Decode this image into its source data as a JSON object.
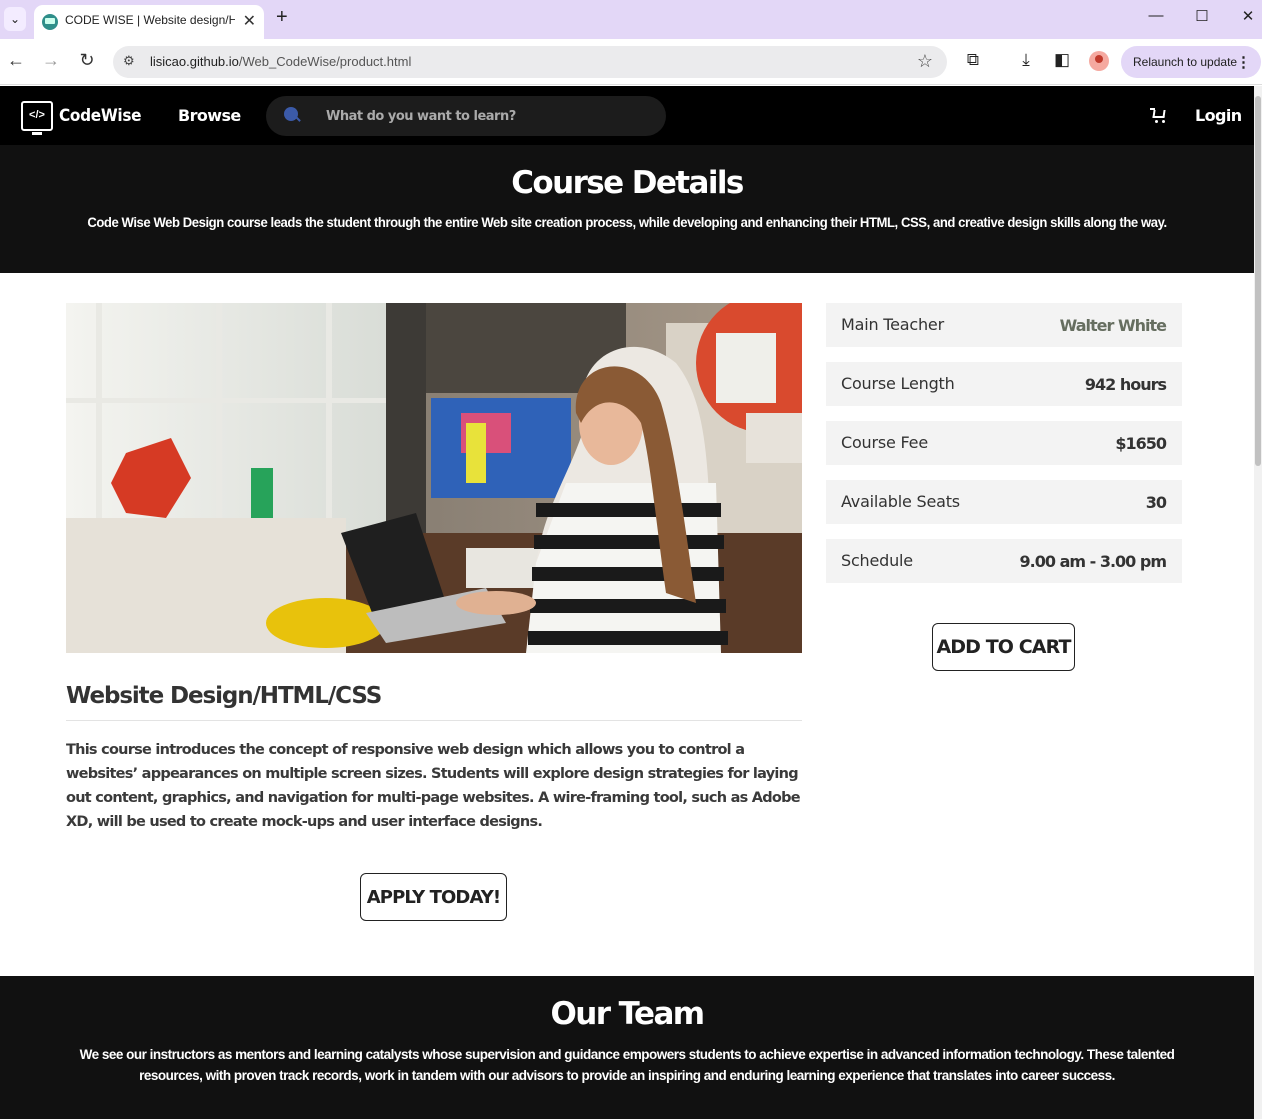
{
  "browser": {
    "tab_title": "CODE WISE | Website design/HTML/CSS",
    "url_host": "lisicao.github.io",
    "url_path": "/Web_CodeWise/product.html",
    "relaunch_label": "Relaunch to update"
  },
  "nav": {
    "logo_text": "CodeWise",
    "browse_label": "Browse",
    "search_placeholder": "What do you want to learn?",
    "login_label": "Login"
  },
  "hero": {
    "title": "Course Details",
    "subtitle": "Code Wise Web Design course leads the student through the entire Web site creation process, while developing and enhancing their HTML, CSS, and creative design skills along the way."
  },
  "course": {
    "title": "Website Design/HTML/CSS",
    "description": "This course introduces the concept of responsive web design which allows you to control a websites’ appearances on multiple screen sizes. Students will explore design strategies for laying out content, graphics, and navigation for multi-page websites. A wire-framing tool, such as Adobe XD, will be used to create mock-ups and user interface designs.",
    "apply_label": "APPLY TODAY!"
  },
  "details": [
    {
      "label": "Main Teacher",
      "value": "Walter White"
    },
    {
      "label": "Course Length",
      "value": "942 hours"
    },
    {
      "label": "Course Fee",
      "value": "$1650"
    },
    {
      "label": "Available Seats",
      "value": "30"
    },
    {
      "label": "Schedule",
      "value": "9.00 am - 3.00 pm"
    }
  ],
  "cart_label": "ADD TO CART",
  "team": {
    "title": "Our Team",
    "text": "We see our instructors as mentors and learning catalysts whose supervision and guidance empowers students to achieve expertise in advanced information technology. These talented resources, with proven track records, work in tandem with our advisors to provide an inspiring and enduring learning experience that translates into career success."
  }
}
